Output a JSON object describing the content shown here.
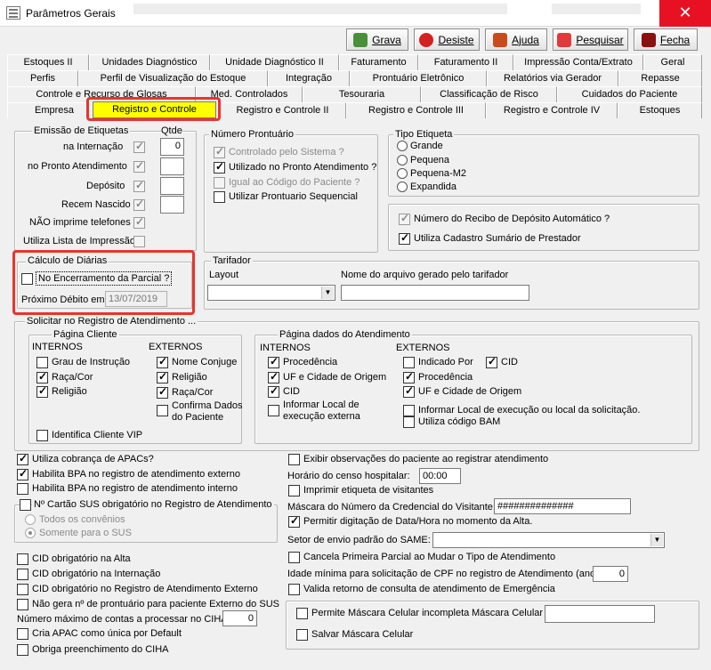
{
  "window": {
    "title": "Parâmetros Gerais",
    "close": "✕"
  },
  "toolbar": {
    "grava": "Grava",
    "desiste": "Desiste",
    "ajuda": "Ajuda",
    "pesquisar": "Pesquisar",
    "fecha": "Fecha"
  },
  "tabs": {
    "row1": [
      "Estoques II",
      "Unidades Diagnóstico",
      "Unidade Diagnóstico II",
      "Faturamento",
      "Faturamento II",
      "Impressão Conta/Extrato",
      "Geral"
    ],
    "row2": [
      "Perfis",
      "Perfil de Visualização do Estoque",
      "Integração",
      "Prontuário Eletrônico",
      "Relatórios via Gerador",
      "Repasse"
    ],
    "row3": [
      "Controle e Recurso de Glosas",
      "Med. Controlados",
      "Tesouraria",
      "Classificação de Risco",
      "Cuidados do Paciente"
    ],
    "row4": [
      "Empresa",
      "Registro e Controle",
      "Registro e Controle II",
      "Registro e Controle III",
      "Registro e Controle IV",
      "Estoques"
    ]
  },
  "emissao": {
    "title": "Emissão de Etiquetas",
    "qtde": "Qtde",
    "internacao": "na Internação",
    "internacao_val": "0",
    "pronto": "no Pronto Atendimento",
    "deposito": "Depósito",
    "recem": "Recem Nascido",
    "nao_imprime": "NÃO imprime telefones",
    "lista": "Utiliza Lista de Impressão"
  },
  "numero_prontuario": {
    "title": "Número Prontuário",
    "sistema": "Controlado pelo Sistema ?",
    "pronto": "Utilizado no Pronto Atendimento ?",
    "igual": "Igual ao Código do Paciente ?",
    "sequencial": "Utilizar Prontuario Sequencial"
  },
  "tipo_etiqueta": {
    "title": "Tipo Etiqueta",
    "grande": "Grande",
    "pequena": "Pequena",
    "pequena_m2": "Pequena-M2",
    "expandida": "Expandida"
  },
  "recibo": {
    "numero": "Número do Recibo de Depósito Automático ?",
    "cadastro": "Utiliza Cadastro Sumário de Prestador"
  },
  "calculo": {
    "title": "Cálculo de Diárias",
    "encerramento": "No Encerramento da Parcial ?",
    "proximo": "Próximo Débito em",
    "proximo_val": "13/07/2019"
  },
  "tarifador": {
    "title": "Tarifador",
    "layout": "Layout",
    "arquivo": "Nome do arquivo gerado pelo tarifador"
  },
  "solicitar": {
    "title": "Solicitar no Registro de Atendimento ...",
    "pagina_cliente": "Página Cliente",
    "internos": "INTERNOS",
    "externos": "EXTERNOS",
    "grau": "Grau de Instrução",
    "raca": "Raça/Cor",
    "religiao": "Religião",
    "nome_conjuge": "Nome Conjuge",
    "religiao_ext": "Religião",
    "raca_ext": "Raça/Cor",
    "confirma1": "Confirma Dados",
    "confirma2": "do Paciente",
    "identifica": "Identifica Cliente VIP",
    "pagina_atend": "Página dados do Atendimento",
    "procedencia": "Procedência",
    "uf": "UF e Cidade de Origem",
    "cid": "CID",
    "informar1": "Informar Local de",
    "informar2": "execução externa",
    "indicado": "Indicado Por",
    "cid_ext": "CID",
    "procedencia_ext": "Procedência",
    "uf_ext": "UF e Cidade de Origem",
    "informar_ext": "Informar Local de execução ou local da solicitação.",
    "bam": "Utiliza código BAM"
  },
  "bottom_left": {
    "apacs": "Utiliza cobrança de APACs?",
    "bpa_ext": "Habilita BPA no registro de atendimento externo",
    "bpa_int": "Habilita BPA no registro de atendimento interno",
    "cartao": "Nº Cartão SUS obrigatório no Registro de Atendimento",
    "todos": "Todos os convênios",
    "somente": "Somente para o SUS",
    "cid_alta": "CID obrigatório na Alta",
    "cid_int": "CID obrigatório na Internação",
    "cid_ext": "CID obrigatório no Registro de Atendimento Externo",
    "nao_gera": "Não gera nº de prontuário para paciente Externo do SUS",
    "numero_max": "Número máximo de contas a processar no CIHA:",
    "numero_max_val": "0",
    "cria_apac": "Cria APAC como única por Default",
    "obriga": "Obriga preenchimento do CIHA"
  },
  "bottom_right": {
    "exibir": "Exibir observações do paciente ao registrar atendimento",
    "horario": "Horário do censo hospitalar:",
    "horario_val": "00:00",
    "imprimir": "Imprimir etiqueta de visitantes",
    "mascara": "Máscara do Número da Credencial do Visitante:",
    "mascara_val": "##############",
    "permitir": "Permitir digitação de Data/Hora no momento da Alta.",
    "setor": "Setor de envio padrão do SAME:",
    "cancela": "Cancela Primeira Parcial ao Mudar o Tipo de Atendimento",
    "idade": "Idade mínima para solicitação de CPF no registro de Atendimento (anos):",
    "idade_val": "0",
    "valida": "Valida retorno de consulta de atendimento de Emergência",
    "permite_celular": "Permite Máscara Celular incompleta",
    "mascara_celular": "Máscara Celular",
    "salvar": "Salvar Máscara Celular"
  }
}
